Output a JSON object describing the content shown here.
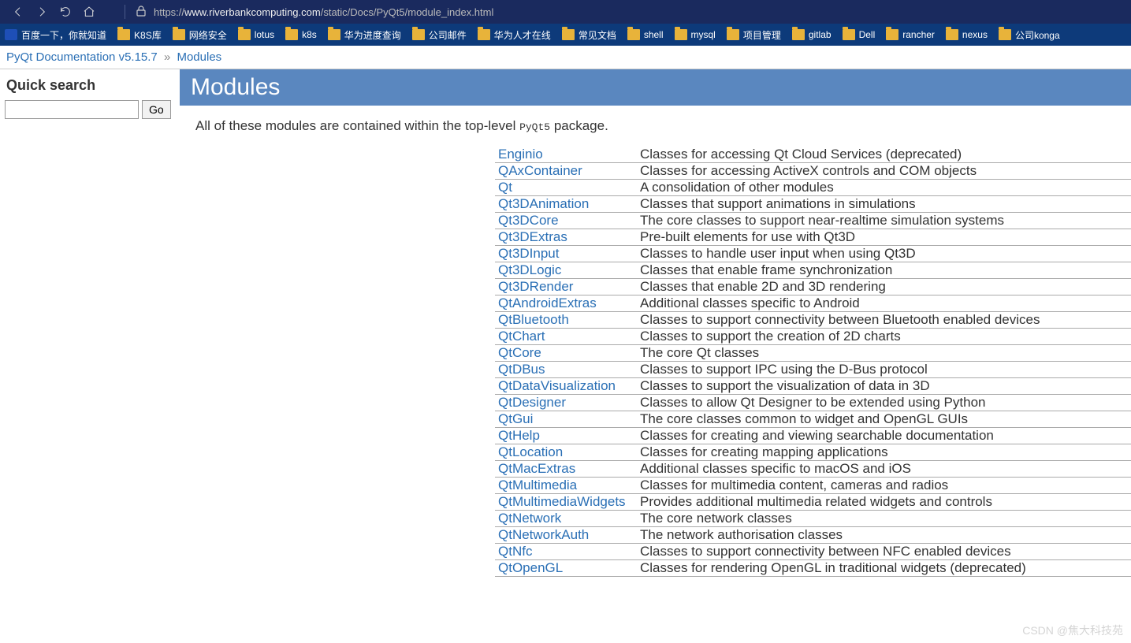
{
  "browser": {
    "url_prefix": "https://",
    "url_host": "www.riverbankcomputing.com",
    "url_path": "/static/Docs/PyQt5/module_index.html"
  },
  "bookmarks": [
    {
      "icon": "baidu",
      "label": "百度一下，你就知道"
    },
    {
      "icon": "folder",
      "label": "K8S库"
    },
    {
      "icon": "folder",
      "label": "网络安全"
    },
    {
      "icon": "folder",
      "label": "lotus"
    },
    {
      "icon": "folder",
      "label": "k8s"
    },
    {
      "icon": "folder",
      "label": "华为进度查询"
    },
    {
      "icon": "folder",
      "label": "公司邮件"
    },
    {
      "icon": "folder",
      "label": "华为人才在线"
    },
    {
      "icon": "folder",
      "label": "常见文档"
    },
    {
      "icon": "folder",
      "label": "shell"
    },
    {
      "icon": "folder",
      "label": "mysql"
    },
    {
      "icon": "folder",
      "label": "项目管理"
    },
    {
      "icon": "folder",
      "label": "gitlab"
    },
    {
      "icon": "folder",
      "label": "Dell"
    },
    {
      "icon": "folder",
      "label": "rancher"
    },
    {
      "icon": "folder",
      "label": "nexus"
    },
    {
      "icon": "folder",
      "label": "公司konga"
    }
  ],
  "breadcrumb": {
    "root": "PyQt Documentation v5.15.7",
    "sep": "»",
    "current": "Modules"
  },
  "sidebar": {
    "quick_search_title": "Quick search",
    "go_label": "Go"
  },
  "page": {
    "title": "Modules",
    "intro_prefix": "All of these modules are contained within the top-level ",
    "intro_code": "PyQt5",
    "intro_suffix": " package."
  },
  "modules": [
    {
      "name": "Enginio",
      "desc": "Classes for accessing Qt Cloud Services (deprecated)"
    },
    {
      "name": "QAxContainer",
      "desc": "Classes for accessing ActiveX controls and COM objects"
    },
    {
      "name": "Qt",
      "desc": "A consolidation of other modules"
    },
    {
      "name": "Qt3DAnimation",
      "desc": "Classes that support animations in simulations"
    },
    {
      "name": "Qt3DCore",
      "desc": "The core classes to support near-realtime simulation systems"
    },
    {
      "name": "Qt3DExtras",
      "desc": "Pre-built elements for use with Qt3D"
    },
    {
      "name": "Qt3DInput",
      "desc": "Classes to handle user input when using Qt3D"
    },
    {
      "name": "Qt3DLogic",
      "desc": "Classes that enable frame synchronization"
    },
    {
      "name": "Qt3DRender",
      "desc": "Classes that enable 2D and 3D rendering"
    },
    {
      "name": "QtAndroidExtras",
      "desc": "Additional classes specific to Android"
    },
    {
      "name": "QtBluetooth",
      "desc": "Classes to support connectivity between Bluetooth enabled devices"
    },
    {
      "name": "QtChart",
      "desc": "Classes to support the creation of 2D charts"
    },
    {
      "name": "QtCore",
      "desc": "The core Qt classes"
    },
    {
      "name": "QtDBus",
      "desc": "Classes to support IPC using the D-Bus protocol"
    },
    {
      "name": "QtDataVisualization",
      "desc": "Classes to support the visualization of data in 3D"
    },
    {
      "name": "QtDesigner",
      "desc": "Classes to allow Qt Designer to be extended using Python"
    },
    {
      "name": "QtGui",
      "desc": "The core classes common to widget and OpenGL GUIs"
    },
    {
      "name": "QtHelp",
      "desc": "Classes for creating and viewing searchable documentation"
    },
    {
      "name": "QtLocation",
      "desc": "Classes for creating mapping applications"
    },
    {
      "name": "QtMacExtras",
      "desc": "Additional classes specific to macOS and iOS"
    },
    {
      "name": "QtMultimedia",
      "desc": "Classes for multimedia content, cameras and radios"
    },
    {
      "name": "QtMultimediaWidgets",
      "desc": "Provides additional multimedia related widgets and controls"
    },
    {
      "name": "QtNetwork",
      "desc": "The core network classes"
    },
    {
      "name": "QtNetworkAuth",
      "desc": "The network authorisation classes"
    },
    {
      "name": "QtNfc",
      "desc": "Classes to support connectivity between NFC enabled devices"
    },
    {
      "name": "QtOpenGL",
      "desc": "Classes for rendering OpenGL in traditional widgets (deprecated)"
    }
  ],
  "watermark": "CSDN @焦大科技苑"
}
